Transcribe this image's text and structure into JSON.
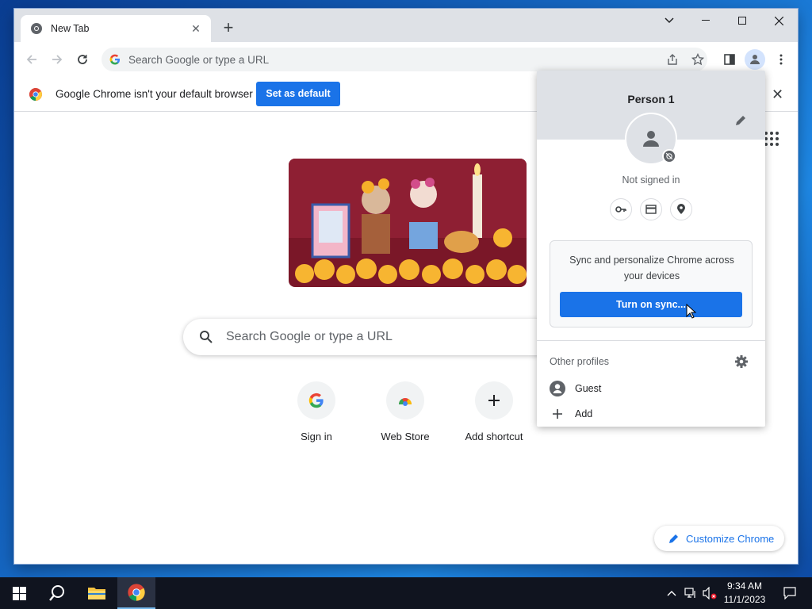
{
  "tab": {
    "title": "New Tab",
    "icon": "chrome-tab-icon"
  },
  "omnibox": {
    "placeholder": "Search Google or type a URL"
  },
  "infobar": {
    "message": "Google Chrome isn't your default browser",
    "button": "Set as default"
  },
  "ntp": {
    "search_placeholder": "Search Google or type a URL",
    "shortcuts": [
      {
        "label": "Sign in",
        "icon": "google-g-icon"
      },
      {
        "label": "Web Store",
        "icon": "web-store-icon"
      },
      {
        "label": "Add shortcut",
        "icon": "plus-icon"
      }
    ],
    "customize_label": "Customize Chrome"
  },
  "profile": {
    "name": "Person 1",
    "status": "Not signed in",
    "sync_text": "Sync and personalize Chrome across your devices",
    "sync_button": "Turn on sync...",
    "other_profiles_label": "Other profiles",
    "guest_label": "Guest",
    "add_label": "Add"
  },
  "taskbar": {
    "time": "9:34 AM",
    "date": "11/1/2023"
  },
  "colors": {
    "accent": "#1a73e8",
    "titlebar": "#dee1e6",
    "taskbar": "#10141f"
  }
}
